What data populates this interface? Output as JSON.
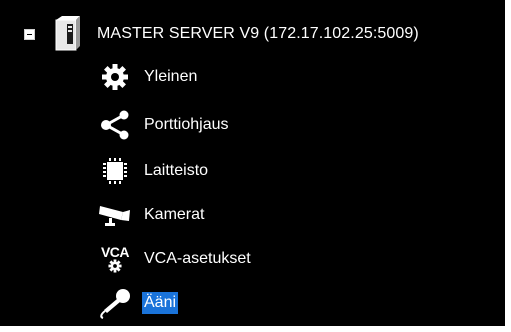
{
  "tree": {
    "root": {
      "label": "MASTER SERVER V9 (172.17.102.25:5009)",
      "expanded": true,
      "icon": "server-icon"
    },
    "children": [
      {
        "label": "Yleinen",
        "icon": "gear-icon",
        "selected": false
      },
      {
        "label": "Porttiohjaus",
        "icon": "share-icon",
        "selected": false
      },
      {
        "label": "Laitteisto",
        "icon": "chip-icon",
        "selected": false
      },
      {
        "label": "Kamerat",
        "icon": "camera-icon",
        "selected": false
      },
      {
        "label": "VCA-asetukset",
        "icon": "vca-settings-icon",
        "icon_text": "VCA",
        "selected": false
      },
      {
        "label": "Ääni",
        "icon": "microphone-icon",
        "selected": true
      }
    ]
  },
  "colors": {
    "background": "#000000",
    "text": "#ffffff",
    "selection": "#1a73d9"
  }
}
